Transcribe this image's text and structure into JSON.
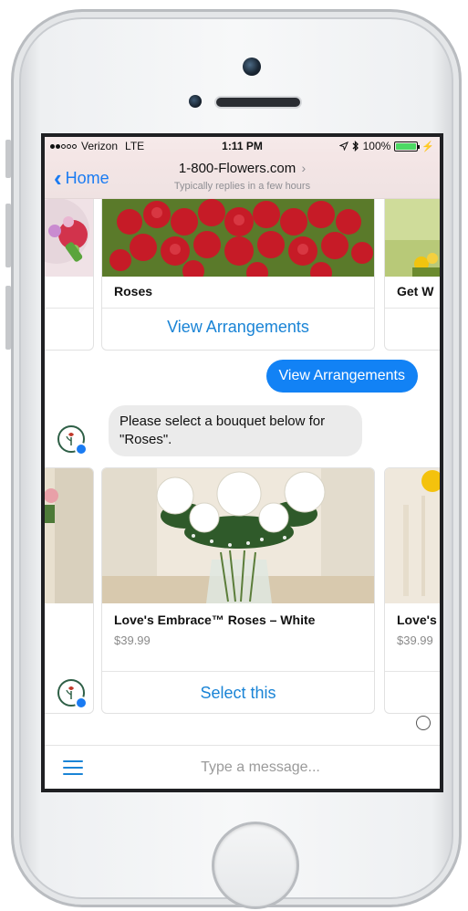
{
  "status_bar": {
    "carrier": "Verizon",
    "network": "LTE",
    "time": "1:11 PM",
    "battery": "100%",
    "battery_level": 1.0,
    "signal_full": 2,
    "signal_total": 5
  },
  "nav": {
    "back_label": "Home",
    "title": "1-800-Flowers.com",
    "subtitle": "Typically replies in a few hours"
  },
  "carousel_top": {
    "cards": [
      {
        "title": "",
        "action": ""
      },
      {
        "title": "Roses",
        "action": "View Arrangements"
      },
      {
        "title": "Get W",
        "action": ""
      }
    ]
  },
  "messages": {
    "outgoing": "View Arrangements",
    "incoming": "Please select a bouquet below for \"Roses\"."
  },
  "carousel_bottom": {
    "cards": [
      {
        "title": "",
        "price": "",
        "action": ""
      },
      {
        "title": "Love's Embrace™ Roses – White",
        "price": "$39.99",
        "action": "Select this"
      },
      {
        "title": "Love's",
        "price": "$39.99",
        "action": ""
      }
    ]
  },
  "composer": {
    "placeholder": "Type a message..."
  },
  "colors": {
    "messenger_blue": "#1282f5",
    "link_blue": "#1a84d6",
    "battery_green": "#4cd964"
  }
}
